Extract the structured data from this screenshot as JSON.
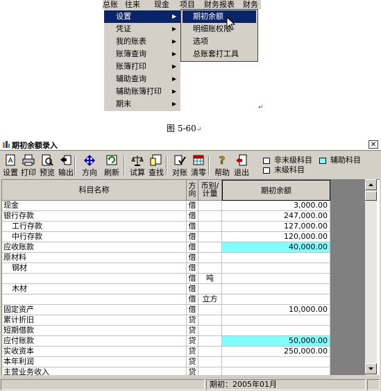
{
  "menubar": {
    "items": [
      "总账",
      "往来",
      "现金",
      "项目",
      "财务报表",
      "财务"
    ]
  },
  "menu1": {
    "items": [
      {
        "label": "设置",
        "arrow": "▶",
        "selected": true
      },
      {
        "label": "凭证",
        "arrow": "▶"
      },
      {
        "label": "我的账表",
        "arrow": "▶"
      },
      {
        "label": "账簿查询",
        "arrow": "▶"
      },
      {
        "label": "账簿打印",
        "arrow": "▶"
      },
      {
        "label": "辅助查询",
        "arrow": "▶"
      },
      {
        "label": "辅助账簿打印",
        "arrow": "▶"
      },
      {
        "label": "期末",
        "arrow": "▶"
      }
    ]
  },
  "menu2": {
    "items": [
      {
        "label": "期初余额",
        "selected": true
      },
      {
        "label": "明细账权限"
      },
      {
        "label": "选项"
      },
      {
        "label": "总账套打工具"
      }
    ]
  },
  "caption": "图 5-60",
  "enter_mark": "↵",
  "window": {
    "title": "期初余额录入",
    "close": "✕",
    "toolbar": [
      {
        "label": "设置",
        "icon": "setup-icon"
      },
      {
        "label": "打印",
        "icon": "print-icon"
      },
      {
        "label": "预览",
        "icon": "preview-icon"
      },
      {
        "label": "输出",
        "icon": "export-icon"
      },
      {
        "label": "方向",
        "icon": "direction-icon"
      },
      {
        "label": "刷新",
        "icon": "refresh-icon"
      },
      {
        "label": "试算",
        "icon": "trial-balance-icon"
      },
      {
        "label": "查找",
        "icon": "find-icon"
      },
      {
        "label": "对账",
        "icon": "reconcile-icon"
      },
      {
        "label": "清零",
        "icon": "clear-icon"
      },
      {
        "label": "帮助",
        "icon": "help-icon"
      },
      {
        "label": "退出",
        "icon": "exit-icon"
      }
    ],
    "legend": {
      "non_final": "非末级科目",
      "auxiliary": "辅助科目",
      "final": "末级科目",
      "auxiliary_color": "#80ffff"
    },
    "grid": {
      "headers": {
        "name": "科目名称",
        "dir": "方向",
        "currency": "币别/计量",
        "balance": "期初余额"
      },
      "rows": [
        {
          "name": "现金",
          "indent": 0,
          "dir": "借",
          "currency": "",
          "balance": "3,000.00",
          "aux": false
        },
        {
          "name": "银行存款",
          "indent": 0,
          "dir": "借",
          "currency": "",
          "balance": "247,000.00",
          "aux": false
        },
        {
          "name": "工行存款",
          "indent": 1,
          "dir": "借",
          "currency": "",
          "balance": "127,000.00",
          "aux": false
        },
        {
          "name": "中行存款",
          "indent": 1,
          "dir": "借",
          "currency": "",
          "balance": "120,000.00",
          "aux": false
        },
        {
          "name": "应收账款",
          "indent": 0,
          "dir": "借",
          "currency": "",
          "balance": "40,000.00",
          "aux": true
        },
        {
          "name": "原材料",
          "indent": 0,
          "dir": "借",
          "currency": "",
          "balance": "",
          "aux": false
        },
        {
          "name": "钢材",
          "indent": 1,
          "dir": "借",
          "currency": "",
          "balance": "",
          "aux": false
        },
        {
          "name": "",
          "indent": 0,
          "dir": "借",
          "currency": "吨",
          "balance": "",
          "aux": false
        },
        {
          "name": "木材",
          "indent": 1,
          "dir": "借",
          "currency": "",
          "balance": "",
          "aux": false
        },
        {
          "name": "",
          "indent": 0,
          "dir": "借",
          "currency": "立方",
          "balance": "",
          "aux": false
        },
        {
          "name": "固定资产",
          "indent": 0,
          "dir": "借",
          "currency": "",
          "balance": "10,000.00",
          "aux": false
        },
        {
          "name": "累计折旧",
          "indent": 0,
          "dir": "贷",
          "currency": "",
          "balance": "",
          "aux": false
        },
        {
          "name": "短期借款",
          "indent": 0,
          "dir": "贷",
          "currency": "",
          "balance": "",
          "aux": false
        },
        {
          "name": "应付账款",
          "indent": 0,
          "dir": "贷",
          "currency": "",
          "balance": "50,000.00",
          "aux": true
        },
        {
          "name": "实收资本",
          "indent": 0,
          "dir": "贷",
          "currency": "",
          "balance": "250,000.00",
          "aux": false
        },
        {
          "name": "本年利润",
          "indent": 0,
          "dir": "贷",
          "currency": "",
          "balance": "",
          "aux": false
        },
        {
          "name": "主营业务收入",
          "indent": 0,
          "dir": "贷",
          "currency": "",
          "balance": "",
          "aux": false
        }
      ]
    },
    "status": {
      "period": "期初：2005年01月"
    }
  }
}
